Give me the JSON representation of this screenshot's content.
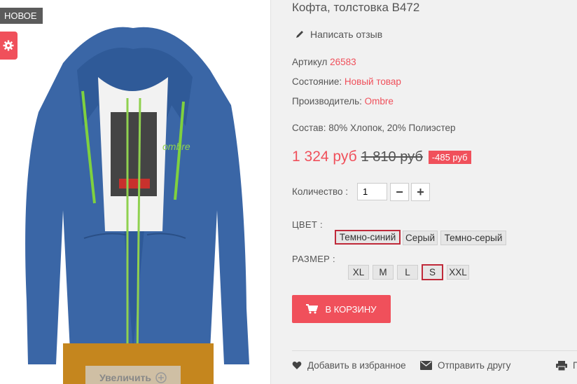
{
  "image": {
    "badge": "НОВОЕ",
    "settings_icon": "gear-icon",
    "zoom_label": "Увеличить",
    "zoom_icon": "zoom-plus-icon",
    "photo_text": "ombre"
  },
  "product": {
    "title": "Кофта, толстовка B472",
    "review_link": "Написать отзыв",
    "sku_label": "Артикул",
    "sku_value": "26583",
    "condition_label": "Состояние:",
    "condition_value": "Новый товар",
    "brand_label": "Производитель:",
    "brand_value": "Ombre",
    "composition": "Состав: 80% Хлопок, 20% Полиэстер",
    "price": "1 324 руб",
    "old_price": "1 810 руб",
    "discount": "-485 руб",
    "quantity_label": "Количество :",
    "quantity_value": "1",
    "minus_label": "−",
    "plus_label": "+",
    "color_label": "ЦВЕТ :",
    "colors": [
      "Темно-синий",
      "Серый",
      "Темно-серый"
    ],
    "selected_color": "Темно-синий",
    "size_label": "РАЗМЕР :",
    "sizes": [
      "XL",
      "M",
      "L",
      "S",
      "XXL"
    ],
    "selected_size": "S",
    "cart_button": "В КОРЗИНУ"
  },
  "actions": {
    "wishlist": "Добавить в избранное",
    "send_friend": "Отправить другу",
    "print": "П"
  },
  "colors": {
    "accent": "#f0505b",
    "selected_border": "#c02a3a",
    "panel_bg": "#f1f1f1"
  }
}
